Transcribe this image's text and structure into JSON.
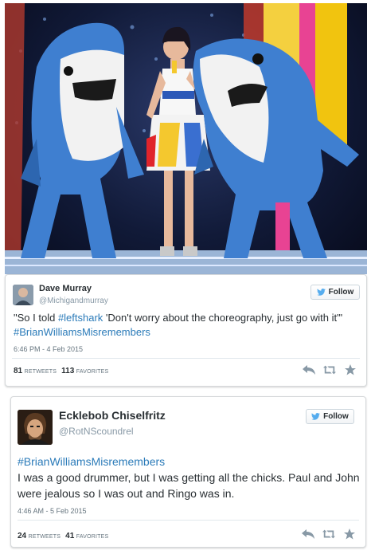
{
  "photo": {
    "subject": "performance-photo"
  },
  "tweets": [
    {
      "display_name": "Dave Murray",
      "handle": "@Michigandmurray",
      "follow_label": "Follow",
      "text_pre": "\"So I told ",
      "mention": "#leftshark",
      "text_mid": " 'Don't worry about the choreography, just go with it'\" ",
      "hashtag": "#BrianWilliamsMisremembers",
      "text_post": "",
      "timestamp": "6:46 PM - 4 Feb 2015",
      "retweets": "81",
      "retweets_label": "RETWEETS",
      "favorites": "113",
      "favorites_label": "FAVORITES"
    },
    {
      "display_name": "Ecklebob Chiselfritz",
      "handle": "@RotNScoundrel",
      "follow_label": "Follow",
      "hashtag": "#BrianWilliamsMisremembers",
      "text_body": "I was a good drummer, but I was getting all the chicks. Paul and John were jealous so I was out and Ringo was in.",
      "timestamp": "4:46 AM - 5 Feb 2015",
      "retweets": "24",
      "retweets_label": "RETWEETS",
      "favorites": "41",
      "favorites_label": "FAVORITES"
    }
  ],
  "colors": {
    "link": "#2b7bb9",
    "bird": "#55acee",
    "muted": "#8899a6"
  },
  "icons": [
    "twitter-bird-icon",
    "reply-icon",
    "retweet-icon",
    "favorite-icon"
  ]
}
